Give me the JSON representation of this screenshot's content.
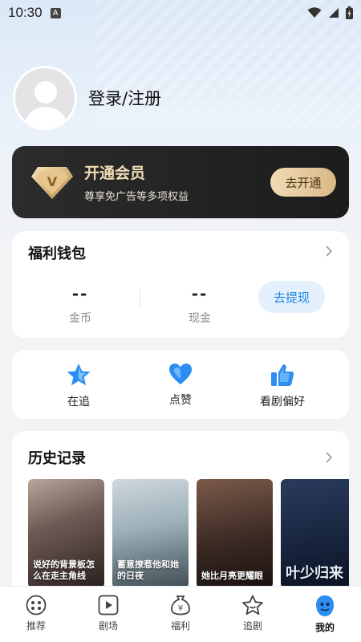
{
  "status_bar": {
    "time": "10:30",
    "notif_letter": "A"
  },
  "profile": {
    "login_text": "登录/注册"
  },
  "vip": {
    "title": "开通会员",
    "subtitle": "尊享免广告等多项权益",
    "button": "去开通",
    "badge_letter": "V"
  },
  "wallet": {
    "title": "福利钱包",
    "coins": {
      "value": "--",
      "label": "金币"
    },
    "cash": {
      "value": "--",
      "label": "现金"
    },
    "withdraw_button": "去提现"
  },
  "actions": [
    {
      "label": "在追",
      "icon": "star-icon"
    },
    {
      "label": "点赞",
      "icon": "heart-icon"
    },
    {
      "label": "看剧偏好",
      "icon": "thumbs-up-icon"
    }
  ],
  "history": {
    "title": "历史记录",
    "posters": [
      {
        "title": "说好的背景板怎么在走主角线"
      },
      {
        "title": "蓄意撩惹他和她的日夜"
      },
      {
        "title": "她比月亮更耀眼"
      },
      {
        "title": "叶少归来"
      }
    ]
  },
  "tabbar": {
    "items": [
      {
        "label": "推荐",
        "icon": "recommend-icon"
      },
      {
        "label": "剧场",
        "icon": "theater-icon"
      },
      {
        "label": "福利",
        "icon": "welfare-icon"
      },
      {
        "label": "追剧",
        "icon": "follow-icon"
      },
      {
        "label": "我的",
        "icon": "profile-icon"
      }
    ],
    "active": "我的"
  },
  "colors": {
    "accent": "#1e88e5",
    "vip_gold": "#f0dcb4",
    "vip_bg": "#1c1c1c"
  }
}
